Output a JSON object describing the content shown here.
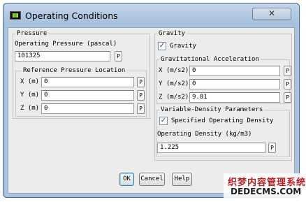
{
  "window": {
    "title": "Operating Conditions",
    "close_glyph": "✕",
    "app_icon": "fluent-app-icon"
  },
  "pressure": {
    "group_title": "Pressure",
    "operating_pressure_label": "Operating Pressure (pascal)",
    "operating_pressure_value": "101325",
    "param_button": "P",
    "reference_location": {
      "group_title": "Reference Pressure Location",
      "rows": [
        {
          "label": "X (m)",
          "value": "0",
          "param": "P"
        },
        {
          "label": "Y (m)",
          "value": "0",
          "param": "P"
        },
        {
          "label": "Z (m)",
          "value": "0",
          "param": "P"
        }
      ]
    }
  },
  "gravity": {
    "group_title": "Gravity",
    "checkbox_label": "Gravity",
    "checked": true,
    "acceleration": {
      "group_title": "Gravitational Acceleration",
      "rows": [
        {
          "label": "X (m/s2)",
          "value": "0",
          "param": "P"
        },
        {
          "label": "Y (m/s2)",
          "value": "0",
          "param": "P"
        },
        {
          "label": "Z (m/s2)",
          "value": "9.81",
          "param": "P"
        }
      ]
    },
    "variable_density": {
      "group_title": "Variable-Density Parameters",
      "checkbox_label": "Specified Operating Density",
      "checked": true,
      "density_label": "Operating Density (kg/m3)",
      "density_value": "1.225",
      "param": "P"
    }
  },
  "buttons": {
    "ok": "OK",
    "cancel": "Cancel",
    "help": "Help"
  },
  "watermark": {
    "line1": "织梦内容管理系统",
    "line2": "DEDECMS.COM"
  },
  "colors": {
    "titlebar": "#a9c3de",
    "dialog_bg": "#ececec",
    "watermark_red": "#b81e22"
  }
}
